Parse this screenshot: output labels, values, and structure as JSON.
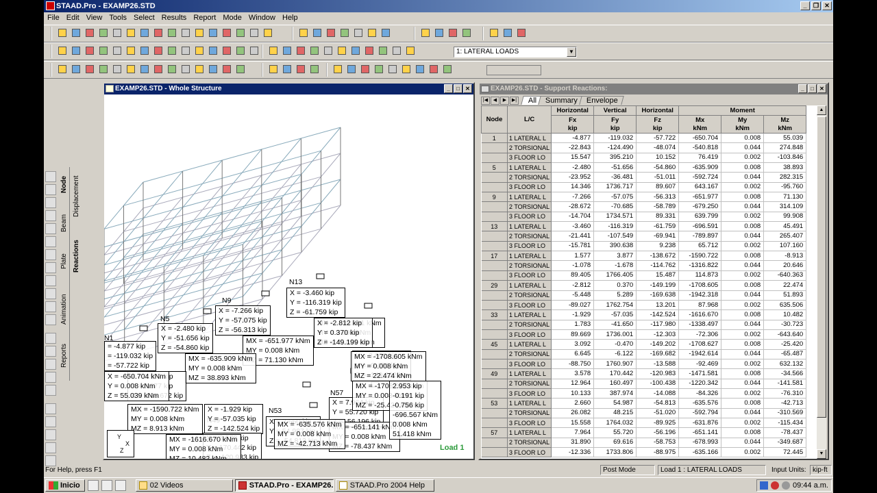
{
  "app": {
    "title": "STAAD.Pro - EXAMP26.STD"
  },
  "menu": [
    "File",
    "Edit",
    "View",
    "Tools",
    "Select",
    "Results",
    "Report",
    "Mode",
    "Window",
    "Help"
  ],
  "toolbar": {
    "load_case": "1: LATERAL LOADS"
  },
  "left_tabs": {
    "node": "Node",
    "beam": "Beam",
    "plate": "Plate",
    "animation": "Animation",
    "reports": "Reports",
    "displacement": "Displacement",
    "reactions": "Reactions"
  },
  "structure_window": {
    "title": "EXAMP26.STD - Whole Structure",
    "load_label": "Load 1",
    "node_labels": [
      "N13",
      "N9",
      "N5",
      "N1",
      "N57",
      "N53",
      "N49"
    ],
    "reaction_boxes": [
      [
        "X = -3.460 kip",
        "Y = -116.319 kip",
        "Z = -61.759 kip"
      ],
      [
        "X = -7.266 kip",
        "Y = -57.075 kip",
        "Z = -56.313 kip"
      ],
      [
        "X = -2.480 kip",
        "Y = -51.656 kip",
        "Z = -54.860 kip"
      ],
      [
        "= -4.877 kip",
        "= -119.032 kip",
        "= -57.722 kip"
      ],
      [
        "MX = -696.591 kNm",
        "MY = 0.008 kNm",
        "MZ = 45.491 kNm"
      ],
      [
        "MX = -651.977 kNm",
        "MY = 0.008 kNm",
        "MZ = 71.130 kNm"
      ],
      [
        "MX = -635.909 kNm",
        "MY = 0.008 kNm",
        "MZ = 38.893 kNm"
      ],
      [
        "X = -1.929 kip",
        "Y = -57.035 kip",
        "Z = -142.524 kip"
      ],
      [
        "X = 2.660 kip",
        "Y = 54.987 kip",
        "Z = -54.813 kip"
      ],
      [
        "X = 7.964 kip",
        "Y = 55.720 kip",
        "Z = -56.196 kip"
      ],
      [
        "MX = -1590.722 kNm",
        "MY = 0.008 kNm",
        "MZ = 8.913 kNm"
      ],
      [
        "MX = -651.141 kNm",
        "MY = 0.008 kNm",
        "MZ = -78.437 kNm"
      ],
      [
        "MX = -635.576 kNm",
        "MY = 0.008 kNm",
        "MZ = -42.713 kNm"
      ],
      [
        "MX = -1708.627 kNm",
        "MY = 0.008 kNm",
        "MZ = -25.420 kNm"
      ],
      [
        "X = 3.092 kip",
        "Y = -0.470 kip",
        "Z = -149.202 kip"
      ],
      [
        "X = 3.578 kip",
        "Y = 170.442 kip",
        "Z = -120.983 kip"
      ],
      [
        "X = -2.812 kip",
        "Y = 0.370 kip",
        "Z = -149.199 kip"
      ],
      [
        "MX = -1708.605 kNm",
        "MY = 0.008 kNm",
        "MZ = 22.474 kNm"
      ],
      [
        "X = 1.577 kip",
        "Y = 3.877 kip",
        "Z = -138.672 kip"
      ],
      [
        "X = -650.704 kNm",
        "Y = 0.008 kNm",
        "Z = 55.039 kNm"
      ],
      [
        "MX = -1616.670 kNm",
        "MY = 0.008 kNm",
        "MZ = 10.482 kNm"
      ],
      [
        "2.953 kip",
        "-0.191 kip",
        "-0.756 kip",
        "-696.567 kNm",
        "0.008 kNm",
        "51.418 kNm"
      ]
    ]
  },
  "reactions_window": {
    "title": "EXAMP26.STD - Support Reactions:",
    "tabs": [
      "All",
      "Summary",
      "Envelope"
    ],
    "headers": {
      "node": "Node",
      "lc": "L/C",
      "horizontal": "Horizontal",
      "vertical": "Vertical",
      "moment": "Moment",
      "fx": "Fx",
      "fy": "Fy",
      "fz": "Fz",
      "mx": "Mx",
      "my": "My",
      "mz": "Mz",
      "kip": "kip",
      "knm": "kNm"
    },
    "rows": [
      [
        "1",
        "1 LATERAL L",
        "-4.877",
        "-119.032",
        "-57.722",
        "-650.704",
        "0.008",
        "55.039"
      ],
      [
        "",
        "2 TORSIONAL",
        "-22.843",
        "-124.490",
        "-48.074",
        "-540.818",
        "0.044",
        "274.848"
      ],
      [
        "",
        "3 FLOOR LO",
        "15.547",
        "395.210",
        "10.152",
        "76.419",
        "0.002",
        "-103.846"
      ],
      [
        "5",
        "1 LATERAL L",
        "-2.480",
        "-51.656",
        "-54.860",
        "-635.909",
        "0.008",
        "38.893"
      ],
      [
        "",
        "2 TORSIONAL",
        "-23.952",
        "-36.481",
        "-51.011",
        "-592.724",
        "0.044",
        "282.315"
      ],
      [
        "",
        "3 FLOOR LO",
        "14.346",
        "1736.717",
        "89.607",
        "643.167",
        "0.002",
        "-95.760"
      ],
      [
        "9",
        "1 LATERAL L",
        "-7.266",
        "-57.075",
        "-56.313",
        "-651.977",
        "0.008",
        "71.130"
      ],
      [
        "",
        "2 TORSIONAL",
        "-28.672",
        "-70.685",
        "-58.789",
        "-679.250",
        "0.044",
        "314.109"
      ],
      [
        "",
        "3 FLOOR LO",
        "-14.704",
        "1734.571",
        "89.331",
        "639.799",
        "0.002",
        "99.908"
      ],
      [
        "13",
        "1 LATERAL L",
        "-3.460",
        "-116.319",
        "-61.759",
        "-696.591",
        "0.008",
        "45.491"
      ],
      [
        "",
        "2 TORSIONAL",
        "-21.441",
        "-107.549",
        "-69.941",
        "-789.897",
        "0.044",
        "265.407"
      ],
      [
        "",
        "3 FLOOR LO",
        "-15.781",
        "390.638",
        "9.238",
        "65.712",
        "0.002",
        "107.160"
      ],
      [
        "17",
        "1 LATERAL L",
        "1.577",
        "3.877",
        "-138.672",
        "-1590.722",
        "0.008",
        "-8.913"
      ],
      [
        "",
        "2 TORSIONAL",
        "-1.078",
        "-1.678",
        "-114.762",
        "-1316.822",
        "0.044",
        "20.646"
      ],
      [
        "",
        "3 FLOOR LO",
        "89.405",
        "1766.405",
        "15.487",
        "114.873",
        "0.002",
        "-640.363"
      ],
      [
        "29",
        "1 LATERAL L",
        "-2.812",
        "0.370",
        "-149.199",
        "-1708.605",
        "0.008",
        "22.474"
      ],
      [
        "",
        "2 TORSIONAL",
        "-5.448",
        "5.289",
        "-169.638",
        "-1942.318",
        "0.044",
        "51.893"
      ],
      [
        "",
        "3 FLOOR LO",
        "-89.027",
        "1762.754",
        "13.201",
        "87.968",
        "0.002",
        "635.506"
      ],
      [
        "33",
        "1 LATERAL L",
        "-1.929",
        "-57.035",
        "-142.524",
        "-1616.670",
        "0.008",
        "10.482"
      ],
      [
        "",
        "2 TORSIONAL",
        "1.783",
        "-41.650",
        "-117.980",
        "-1338.497",
        "0.044",
        "-30.723"
      ],
      [
        "",
        "3 FLOOR LO",
        "89.669",
        "1736.001",
        "-12.303",
        "-72.306",
        "0.002",
        "-643.640"
      ],
      [
        "45",
        "1 LATERAL L",
        "3.092",
        "-0.470",
        "-149.202",
        "-1708.627",
        "0.008",
        "-25.420"
      ],
      [
        "",
        "2 TORSIONAL",
        "6.645",
        "-6.122",
        "-169.682",
        "-1942.614",
        "0.044",
        "-65.487"
      ],
      [
        "",
        "3 FLOOR LO",
        "-88.750",
        "1760.907",
        "-13.588",
        "-92.469",
        "0.002",
        "632.132"
      ],
      [
        "49",
        "1 LATERAL L",
        "3.578",
        "170.442",
        "-120.983",
        "-1471.581",
        "0.008",
        "-34.566"
      ],
      [
        "",
        "2 TORSIONAL",
        "12.964",
        "160.497",
        "-100.438",
        "-1220.342",
        "0.044",
        "-141.581"
      ],
      [
        "",
        "3 FLOOR LO",
        "10.133",
        "387.974",
        "-14.088",
        "-84.326",
        "0.002",
        "-76.310"
      ],
      [
        "53",
        "1 LATERAL L",
        "2.660",
        "54.987",
        "-54.813",
        "-635.576",
        "0.008",
        "-42.713"
      ],
      [
        "",
        "2 TORSIONAL",
        "26.082",
        "48.215",
        "-51.020",
        "-592.794",
        "0.044",
        "-310.569"
      ],
      [
        "",
        "3 FLOOR LO",
        "15.558",
        "1764.032",
        "-89.925",
        "-631.876",
        "0.002",
        "-115.434"
      ],
      [
        "57",
        "1 LATERAL L",
        "7.964",
        "55.720",
        "-56.196",
        "-651.141",
        "0.008",
        "-78.437"
      ],
      [
        "",
        "2 TORSIONAL",
        "31.890",
        "69.616",
        "-58.753",
        "-678.993",
        "0.044",
        "-349.687"
      ],
      [
        "",
        "3 FLOOR LO",
        "-12.336",
        "1733.806",
        "-88.975",
        "-635.166",
        "0.002",
        "72.445"
      ]
    ]
  },
  "status": {
    "help": "For Help, press F1",
    "mode": "Post Mode",
    "load": "Load 1 : LATERAL LOADS",
    "units_label": "Input Units:",
    "units": "kip-ft"
  },
  "taskbar": {
    "start": "Inicio",
    "items": [
      "02 Videos",
      "STAAD.Pro - EXAMP26...",
      "STAAD.Pro 2004 Help"
    ],
    "clock": "09:44 a.m."
  }
}
